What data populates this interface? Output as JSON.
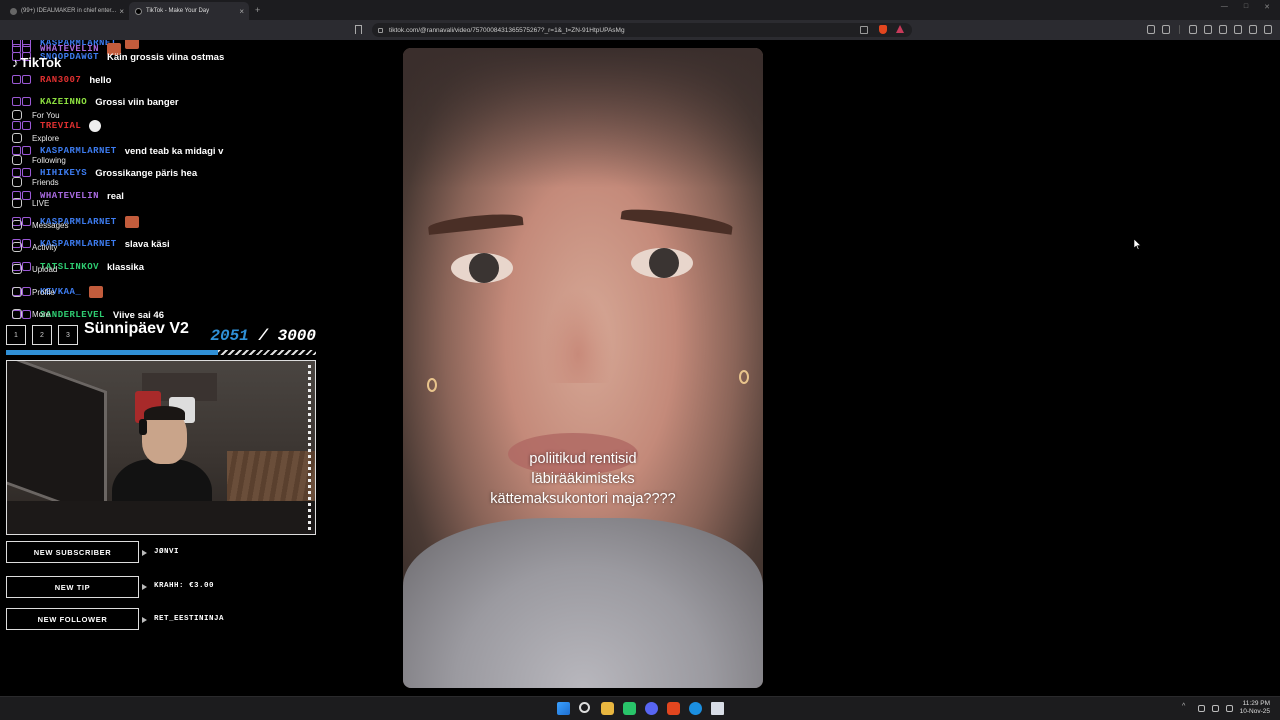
{
  "browser": {
    "tabs": [
      {
        "title": "(99+) IDEALMAKER in chief enter..."
      },
      {
        "title": "TikTok - Make Your Day"
      }
    ],
    "new_tab": "+",
    "url": "tiktok.com/@rannavali/video/7570008431365575267?_r=1&_t=ZN-91HtpUPAsMg"
  },
  "tiktok_nav": {
    "logo": "TikTok",
    "items": [
      "For You",
      "Explore",
      "Following",
      "Friends",
      "LIVE",
      "Messages",
      "Activity",
      "Upload",
      "Profile",
      "More"
    ]
  },
  "chat": {
    "messages": [
      {
        "user": "KASPARMLARNET",
        "text": "",
        "color": "#3d7cf0"
      },
      {
        "user": "WHATEVELIN",
        "text": "",
        "color": "#a86ae0"
      },
      {
        "user": "SNOOPDAWGT",
        "text": "Käin grossis viina ostmas",
        "color": "#3d7cf0"
      },
      {
        "user": "RAN3007",
        "text": "hello",
        "color": "#e03030"
      },
      {
        "user": "KAZEINNO",
        "text": "Grossi viin banger",
        "color": "#8de040"
      },
      {
        "user": "TREVIAL",
        "text": "",
        "color": "#e03030"
      },
      {
        "user": "KASPARMLARNET",
        "text": "vend teab ka midagi v",
        "color": "#3d7cf0"
      },
      {
        "user": "HIHIKEYS",
        "text": "Grossikange päris hea",
        "color": "#3d7cf0"
      },
      {
        "user": "WHATEVELIN",
        "text": "real",
        "color": "#a86ae0"
      },
      {
        "user": "KASPARMLARNET",
        "text": "",
        "color": "#3d7cf0"
      },
      {
        "user": "KASPARMLARNET",
        "text": "slava käsi",
        "color": "#3d7cf0"
      },
      {
        "user": "TATSLINKOV",
        "text": "klassika",
        "color": "#2ecc71"
      },
      {
        "user": "KEVKAA_",
        "text": "",
        "color": "#3d7cf0"
      },
      {
        "user": "SANDERLEVEL",
        "text": "Viive sai 46",
        "color": "#2ecc71"
      }
    ]
  },
  "goal": {
    "title": "Sünnipäev V2",
    "current": "2051",
    "separator": "/",
    "total": "3000",
    "progress": 0.6837,
    "dice": [
      "1",
      "2",
      "3"
    ]
  },
  "alerts": [
    {
      "label": "NEW SUBSCRIBER",
      "value": "JØNVI"
    },
    {
      "label": "NEW TIP",
      "value": "KRAHH: €3.00"
    },
    {
      "label": "NEW FOLLOWER",
      "value": "RET_EESTININJA"
    }
  ],
  "video": {
    "caption_lines": [
      "poliitikud rentisid",
      "läbirääkimisteks",
      "kättemaksukontori maja????"
    ]
  },
  "taskbar": {
    "time": "11:29 PM",
    "date": "10-Nov-25"
  },
  "colors": {
    "accent_blue": "#2f8fd6",
    "chrome_bg": "#2b2b30"
  }
}
